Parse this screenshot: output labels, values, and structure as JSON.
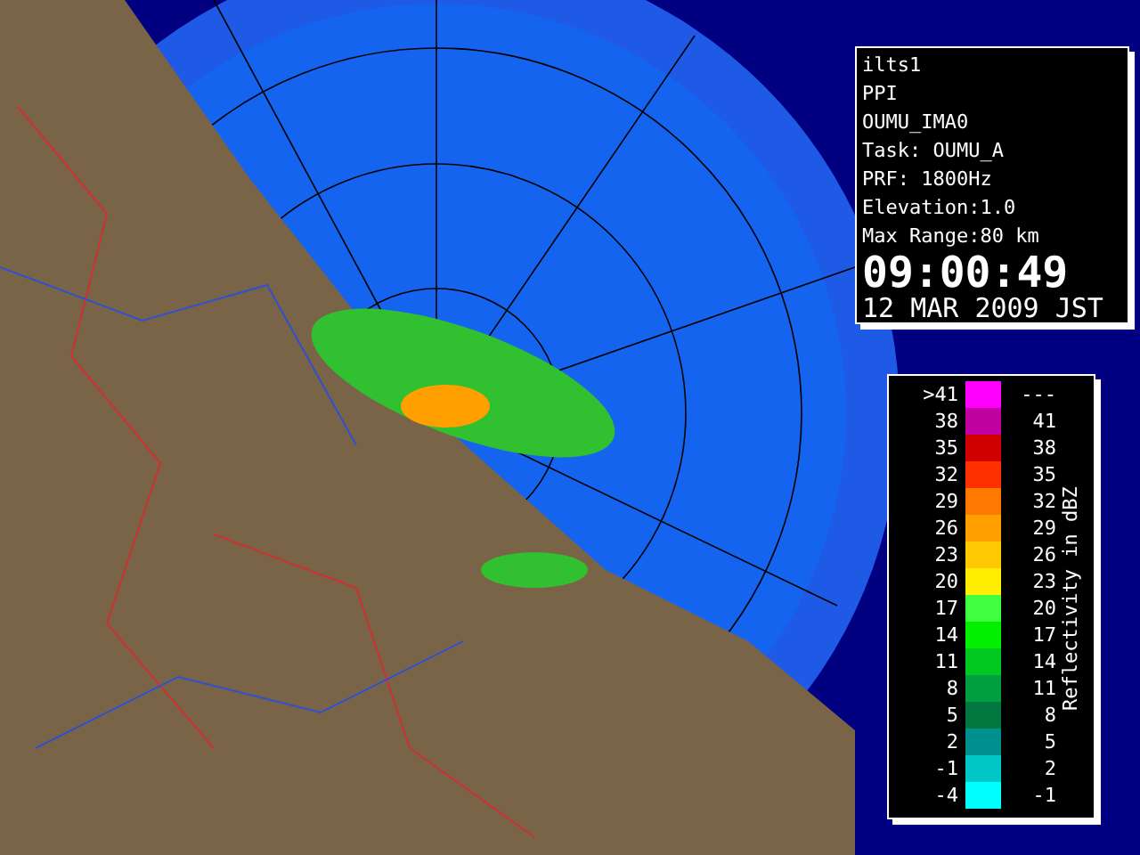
{
  "info_panel": {
    "lines": [
      "ilts1",
      "PPI",
      "OUMU_IMA0",
      "Task: OUMU_A",
      "PRF: 1800Hz",
      "Elevation:1.0",
      "Max Range:80 km"
    ],
    "time": "09:00:49",
    "date": "12 MAR 2009 JST"
  },
  "legend": {
    "title": "Reflectivity in dBZ",
    "rows": [
      {
        "low": ">41",
        "high": "---",
        "color": "#ff00ff"
      },
      {
        "low": "38",
        "high": "41",
        "color": "#c000a0"
      },
      {
        "low": "35",
        "high": "38",
        "color": "#d00000"
      },
      {
        "low": "32",
        "high": "35",
        "color": "#ff3000"
      },
      {
        "low": "29",
        "high": "32",
        "color": "#ff7800"
      },
      {
        "low": "26",
        "high": "29",
        "color": "#ffa000"
      },
      {
        "low": "23",
        "high": "26",
        "color": "#ffc800"
      },
      {
        "low": "20",
        "high": "23",
        "color": "#ffee00"
      },
      {
        "low": "17",
        "high": "20",
        "color": "#40ff40"
      },
      {
        "low": "14",
        "high": "17",
        "color": "#00f000"
      },
      {
        "low": "11",
        "high": "14",
        "color": "#00c820"
      },
      {
        "low": "8",
        "high": "11",
        "color": "#00a040"
      },
      {
        "low": "5",
        "high": "8",
        "color": "#007840"
      },
      {
        "low": "2",
        "high": "5",
        "color": "#009090"
      },
      {
        "low": "-1",
        "high": "2",
        "color": "#00c8c8"
      },
      {
        "low": "-4",
        "high": "-1",
        "color": "#00ffff"
      }
    ]
  }
}
